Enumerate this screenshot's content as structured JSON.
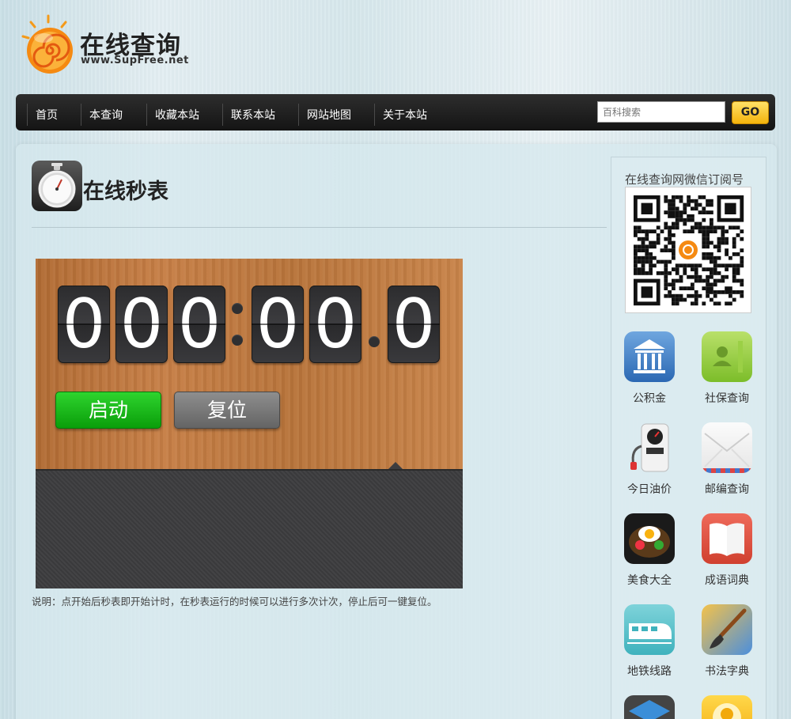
{
  "site": {
    "title": "在线查询",
    "url": "www.SupFree.net"
  },
  "nav": {
    "items": [
      "首页",
      "本查询",
      "收藏本站",
      "联系本站",
      "网站地图",
      "关于本站"
    ],
    "search_placeholder": "百科搜索",
    "go_label": "GO"
  },
  "page": {
    "title": "在线秒表"
  },
  "stopwatch": {
    "digits": [
      "0",
      "0",
      "0",
      "0",
      "0",
      "0",
      "0"
    ],
    "start_label": "启动",
    "reset_label": "复位"
  },
  "note": "说明：点开始后秒表即开始计时，在秒表运行的时候可以进行多次计次，停止后可一键复位。",
  "sidebar": {
    "title": "在线查询网微信订阅号",
    "apps": [
      {
        "label": "公积金",
        "icon": "bank-icon"
      },
      {
        "label": "社保查询",
        "icon": "contact-book-icon"
      },
      {
        "label": "今日油价",
        "icon": "fuel-pump-icon"
      },
      {
        "label": "邮编查询",
        "icon": "envelope-icon"
      },
      {
        "label": "美食大全",
        "icon": "food-bowl-icon"
      },
      {
        "label": "成语词典",
        "icon": "open-book-icon"
      },
      {
        "label": "地铁线路",
        "icon": "train-icon"
      },
      {
        "label": "书法字典",
        "icon": "brush-icon"
      },
      {
        "label": "",
        "icon": "layers-icon"
      },
      {
        "label": "",
        "icon": "avatar-icon"
      }
    ]
  },
  "colors": {
    "start_button": "#0fb10f",
    "reset_button": "#747474",
    "go_button": "#f8c530",
    "nav_bg": "#1e1e1e"
  }
}
